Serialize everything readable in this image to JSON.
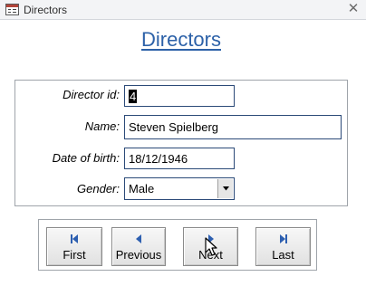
{
  "window": {
    "title": "Directors"
  },
  "form": {
    "title": "Directors",
    "fields": {
      "director_id": {
        "label": "Director id:",
        "value": "4"
      },
      "name": {
        "label": "Name:",
        "value": "Steven Spielberg"
      },
      "dob": {
        "label": "Date of birth:",
        "value": "18/12/1946"
      },
      "gender": {
        "label": "Gender:",
        "value": "Male"
      }
    }
  },
  "nav": {
    "first": "First",
    "previous": "Previous",
    "next": "Next",
    "last": "Last"
  },
  "colors": {
    "title": "#2c61a8",
    "nav_icon": "#2d5fb0",
    "field_border": "#2b4a78"
  },
  "icons": [
    "form-icon",
    "close-icon",
    "first-record-icon",
    "previous-record-icon",
    "next-record-icon",
    "last-record-icon",
    "dropdown-arrow-icon",
    "mouse-pointer-icon"
  ]
}
